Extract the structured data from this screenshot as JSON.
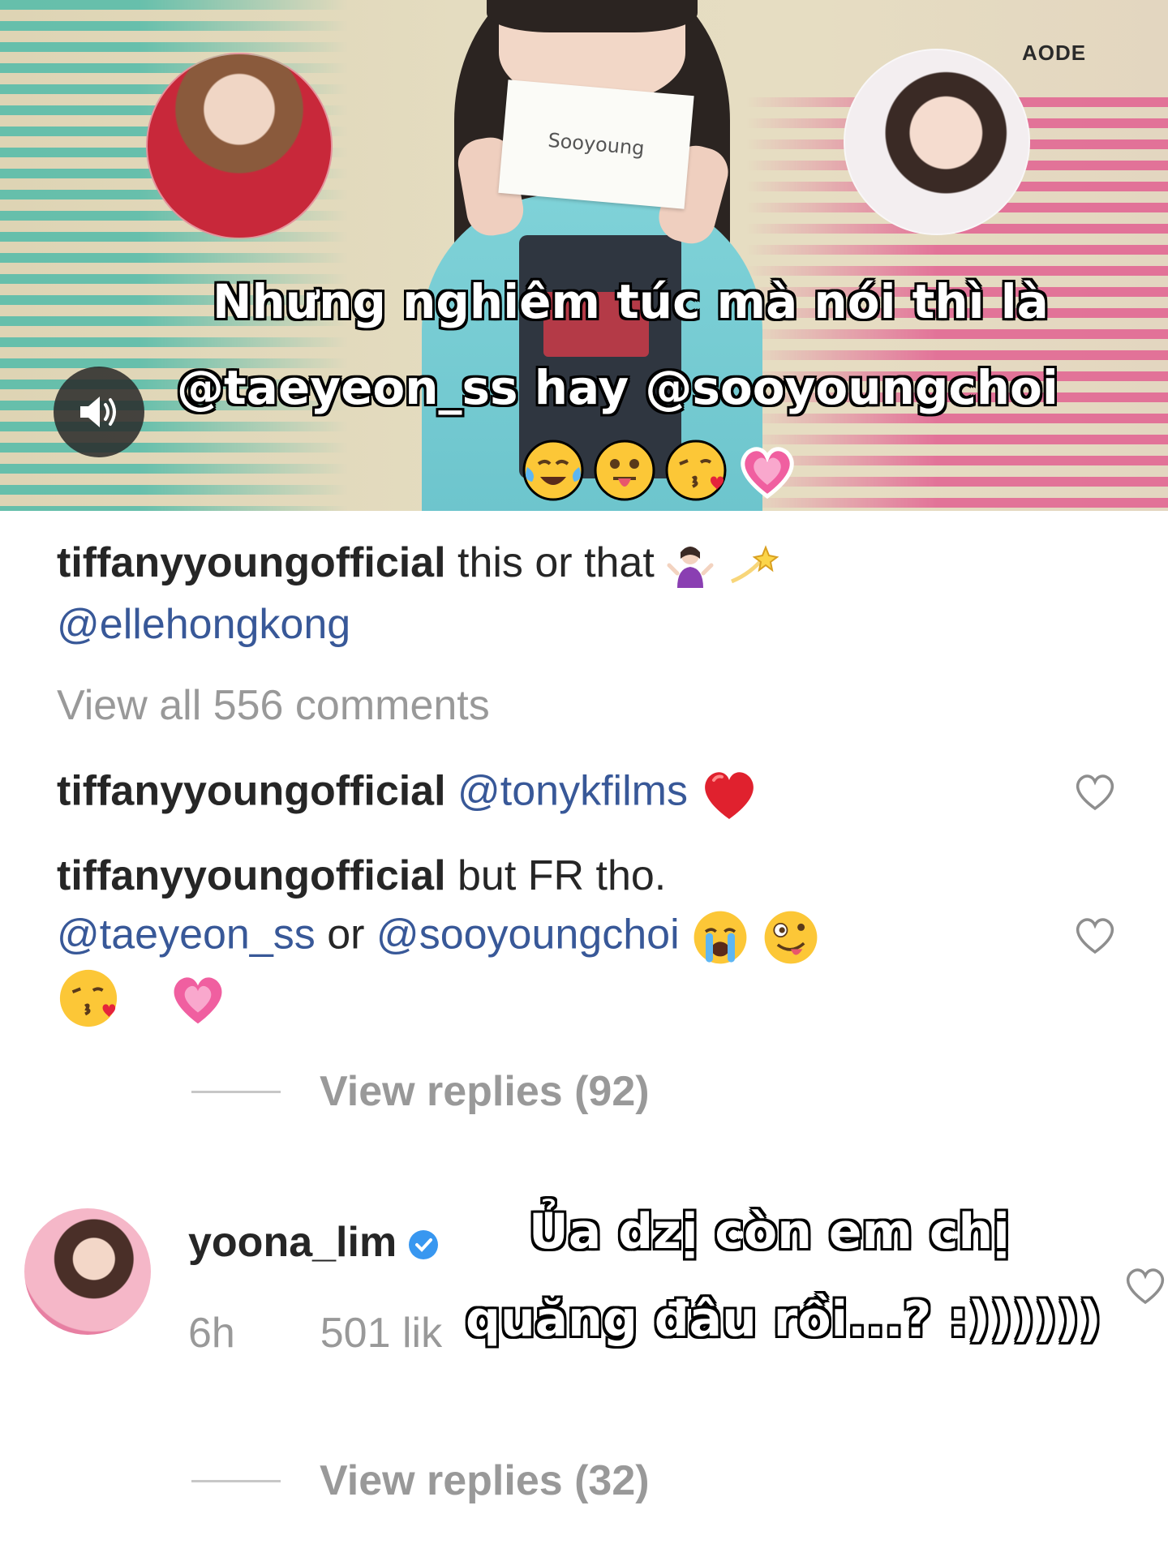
{
  "video": {
    "card_text": "Sooyoung",
    "watermark": "AODE",
    "overlay_line1": "Nhưng nghiêm túc mà nói thì là",
    "overlay_line2": "@taeyeon_ss hay @sooyoungchoi",
    "overlay_emojis": [
      "face-with-tears",
      "face-with-tongue",
      "face-blowing-kiss",
      "growing-heart"
    ]
  },
  "caption": {
    "username": "tiffanyyoungofficial",
    "text": "this or that",
    "emojis": [
      "person-shrugging",
      "dizzy"
    ],
    "mention": "@ellehongkong"
  },
  "view_all": "View all 556 comments",
  "comments": [
    {
      "username": "tiffanyyoungofficial",
      "mention": "@tonykfilms",
      "emoji": "red-heart"
    },
    {
      "username": "tiffanyyoungofficial",
      "text": "but FR tho.",
      "mention1": "@taeyeon_ss",
      "connector": "or",
      "mention2": "@sooyoungchoi",
      "emojis": [
        "loudly-crying-face",
        "zany-face",
        "face-blowing-kiss",
        "growing-heart"
      ],
      "replies": "View replies (92)"
    },
    {
      "username": "yoona_lim",
      "verified": true,
      "time": "6h",
      "likes": "501 lik",
      "replies": "View replies (32)"
    }
  ],
  "overlay_bottom": {
    "line1": "Ủa dzị còn em chị",
    "line2": "quăng đâu rồi...? :))))))"
  },
  "colors": {
    "mention": "#385898",
    "muted": "#999999",
    "text": "#262626",
    "verified": "#3897f0"
  }
}
